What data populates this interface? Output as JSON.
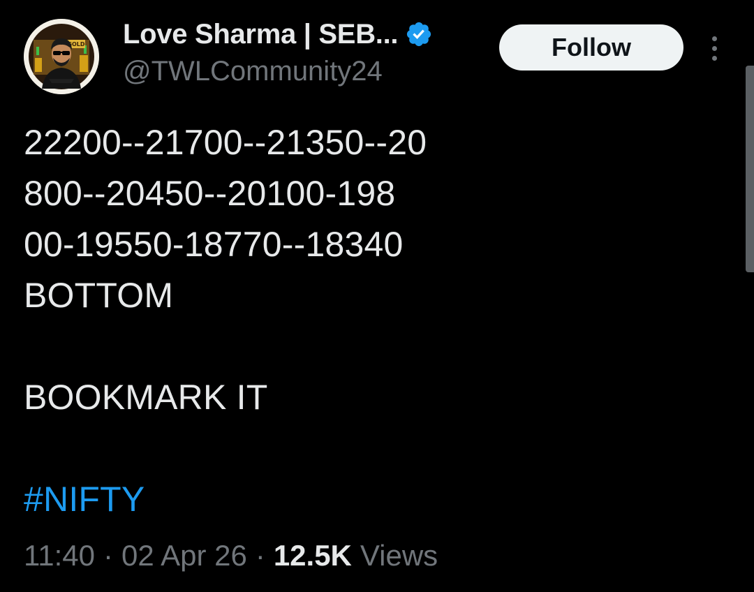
{
  "author": {
    "display_name": "Love Sharma | SEB...",
    "handle": "@TWLCommunity24",
    "verified": true,
    "avatar_badge_text": "GOLD"
  },
  "actions": {
    "follow_label": "Follow",
    "more_icon": "more-vertical-icon"
  },
  "post": {
    "lines": [
      "22200--21700--21350--20",
      "800--20450--20100-198",
      "00-19550-18770--18340",
      "BOTTOM",
      "",
      "BOOKMARK IT",
      "",
      "#NIFTY"
    ],
    "hashtag": "#NIFTY"
  },
  "meta": {
    "time": "11:40",
    "separator": "·",
    "date": "02 Apr 26",
    "views_count": "12.5K",
    "views_label": "Views"
  },
  "colors": {
    "background": "#000000",
    "text_primary": "#e7e9ea",
    "text_secondary": "#71767b",
    "accent_blue": "#1d9bf0",
    "follow_bg": "#eff3f4"
  }
}
